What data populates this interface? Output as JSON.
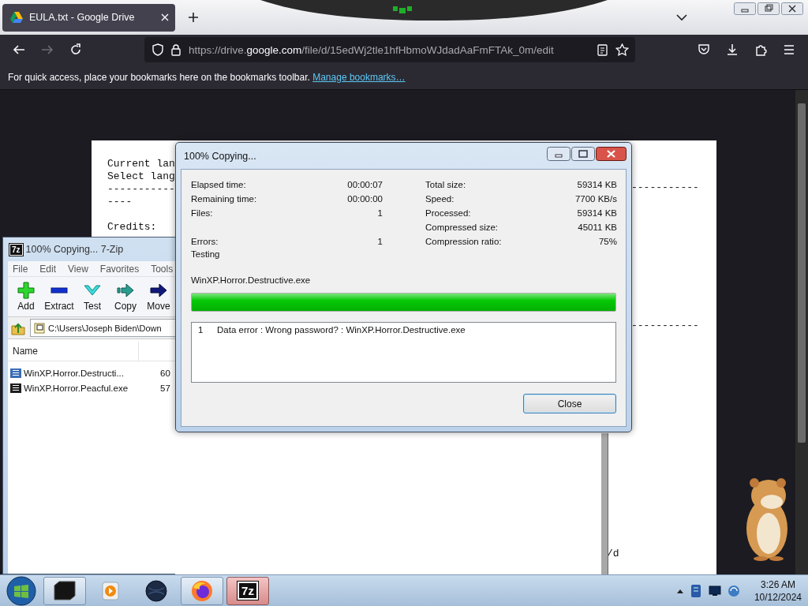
{
  "browser": {
    "tab": {
      "title": "EULA.txt - Google Drive",
      "selected": true
    },
    "nav_buttons": [
      {
        "kind": "back",
        "disabled": false
      },
      {
        "kind": "forward",
        "disabled": true
      },
      {
        "kind": "reload",
        "disabled": false
      }
    ],
    "url": "https://drive.**google.com**/file/d/15edWj2tle1hfHbmoWJdadAaFmFTAk_0m/edit",
    "bookmarks_hint": "For quick access, place your bookmarks here on the bookmarks toolbar.",
    "bookmarks_link": "Manage bookmarks…"
  },
  "document": {
    "left_blocks": [
      [
        "Current lan",
        "Select lang",
        "-----------",
        "----"
      ],
      [
        "Credits:"
      ]
    ],
    "right_fragments": [
      "-----------",
      "-----------",
      "/d"
    ]
  },
  "zip_window": {
    "icon_label": "7z",
    "title": "100% Copying... 7-Zip",
    "menu": [
      "File",
      "Edit",
      "View",
      "Favorites",
      "Tools"
    ],
    "toolbar": [
      {
        "kind": "add",
        "label": "Add"
      },
      {
        "kind": "extract",
        "label": "Extract"
      },
      {
        "kind": "test",
        "label": "Test"
      },
      {
        "kind": "copy",
        "label": "Copy"
      },
      {
        "kind": "move",
        "label": "Move"
      }
    ],
    "path": "C:\\Users\\Joseph Biden\\Down",
    "columns": [
      "Name"
    ],
    "rows": [
      {
        "name": "WinXP.Horror.Destructi...",
        "column_2": "60",
        "color": "#3a6db5"
      },
      {
        "name": "WinXP.Horror.Peacful.exe",
        "column_2": "57",
        "color": "#1e1e1e"
      }
    ]
  },
  "dialog": {
    "title": "100% Copying...",
    "stats": [
      {
        "left": {
          "label": "Elapsed time:",
          "value": "00:00:07"
        },
        "right": {
          "label": "Total size:",
          "value": "59314 KB"
        }
      },
      {
        "left": {
          "label": "Remaining time:",
          "value": "00:00:00"
        },
        "right": {
          "label": "Speed:",
          "value": "7700 KB/s"
        }
      },
      {
        "left": {
          "label": "Files:",
          "value": "1"
        },
        "right": {
          "label": "Processed:",
          "value": "59314 KB"
        }
      },
      {
        "right": {
          "label": "Compressed size:",
          "value": "45011 KB"
        }
      },
      {
        "left": {
          "label": "Errors:",
          "value": "1"
        },
        "right": {
          "label": "Compression ratio:",
          "value": "75%"
        }
      }
    ],
    "status": "Testing",
    "file": "WinXP.Horror.Destructive.exe",
    "progress": {
      "level": 1
    },
    "messages": [
      {
        "number": "1",
        "text": "Data error : Wrong password? : WinXP.Horror.Destructive.exe"
      }
    ],
    "buttons": [
      "Close"
    ]
  },
  "taskbar": {
    "apps": [
      {
        "kind": "terminal",
        "running": true,
        "selected": false
      },
      {
        "kind": "media",
        "running": false,
        "selected": false
      },
      {
        "kind": "globe",
        "running": false,
        "selected": false
      },
      {
        "kind": "firefox",
        "running": true,
        "selected": false
      },
      {
        "kind": "sevenzip",
        "label": "7z",
        "running": true,
        "selected": true
      }
    ],
    "clock": {
      "time": "3:26 AM",
      "date": "10/12/2024"
    }
  }
}
